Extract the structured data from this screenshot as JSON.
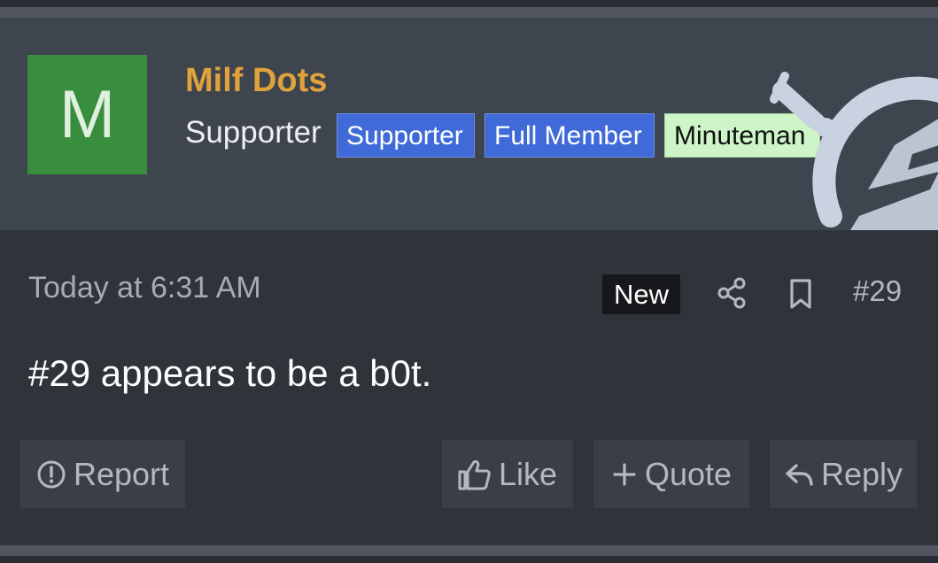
{
  "user": {
    "avatar_letter": "M",
    "name": "Milf Dots",
    "title": "Supporter",
    "banners": [
      "Supporter",
      "Full Member",
      "Minuteman"
    ]
  },
  "message": {
    "date": "Today at 6:31 AM",
    "badge": "New",
    "number": "#29",
    "body": "#29 appears to be a b0t."
  },
  "actions": {
    "report": "Report",
    "like": "Like",
    "quote": "Quote",
    "reply": "Reply"
  },
  "icons": {
    "share": "share-icon",
    "bookmark": "bookmark-icon",
    "report": "alert-circle-icon",
    "like": "thumbs-up-icon",
    "quote": "plus-icon",
    "reply": "reply-arrow-icon"
  },
  "colors": {
    "username": "#e0a23a",
    "avatar_bg": "#388e3c",
    "banner_blue": "#3f6ad8",
    "banner_green": "#cdf5c8"
  }
}
